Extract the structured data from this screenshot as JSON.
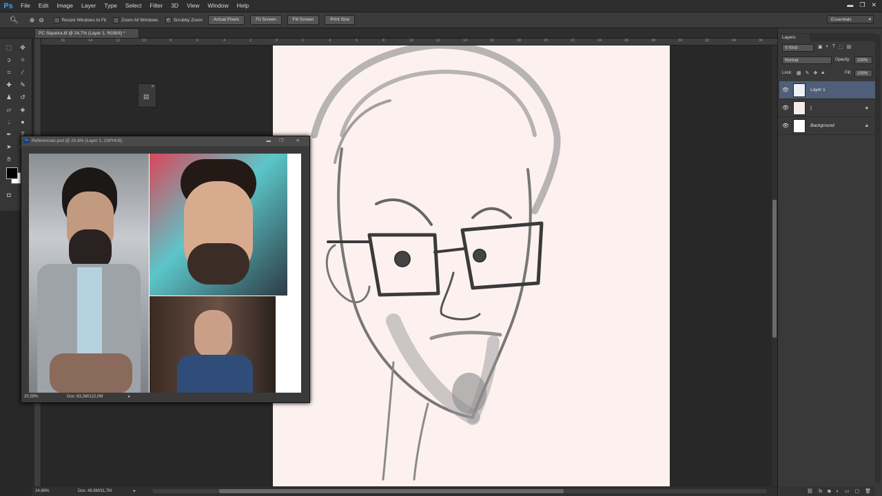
{
  "app": {
    "logo": "Ps"
  },
  "menu": [
    "File",
    "Edit",
    "Image",
    "Layer",
    "Type",
    "Select",
    "Filter",
    "3D",
    "View",
    "Window",
    "Help"
  ],
  "window_controls": {
    "minimize": "▬",
    "restore": "❐",
    "close": "✕"
  },
  "options_bar": {
    "resize_windows": "Resize Windows to Fit",
    "zoom_all": "Zoom All Windows",
    "scrubby_zoom": "Scrubby Zoom",
    "scrubby_checked": "✓",
    "actual_pixels": "Actual Pixels",
    "fit_screen": "Fit Screen",
    "fill_screen": "Fill Screen",
    "print_size": "Print Size"
  },
  "workspace": "Essentials",
  "document_tab": "PC Siqueira.tif @ 24,7% (Layer 1, RGB/8) *",
  "ruler_ticks": [
    "16",
    "14",
    "12",
    "10",
    "8",
    "6",
    "4",
    "2",
    "0",
    "2",
    "4",
    "6",
    "8",
    "10",
    "12",
    "14",
    "16",
    "18",
    "20",
    "22",
    "24",
    "26",
    "28",
    "30",
    "32",
    "34",
    "36"
  ],
  "reference_window": {
    "title": "Referencias.psd @ 20,6% (Layer 1, CMYK/8)",
    "zoom": "20,59%",
    "doc": "Doc: 63,2M/122,0M"
  },
  "status": {
    "zoom": "24,66%",
    "doc": "Doc: 49,8M/31,7M"
  },
  "layers_panel": {
    "tab": "Layers",
    "kind": "Kind",
    "blend": "Normal",
    "opacity_label": "Opacity:",
    "opacity": "100%",
    "lock_label": "Lock:",
    "fill_label": "Fill:",
    "fill": "100%",
    "layers": [
      {
        "name": "Layer 1",
        "selected": true
      },
      {
        "name": "]",
        "selected": false
      },
      {
        "name": "Background",
        "selected": false
      }
    ]
  }
}
